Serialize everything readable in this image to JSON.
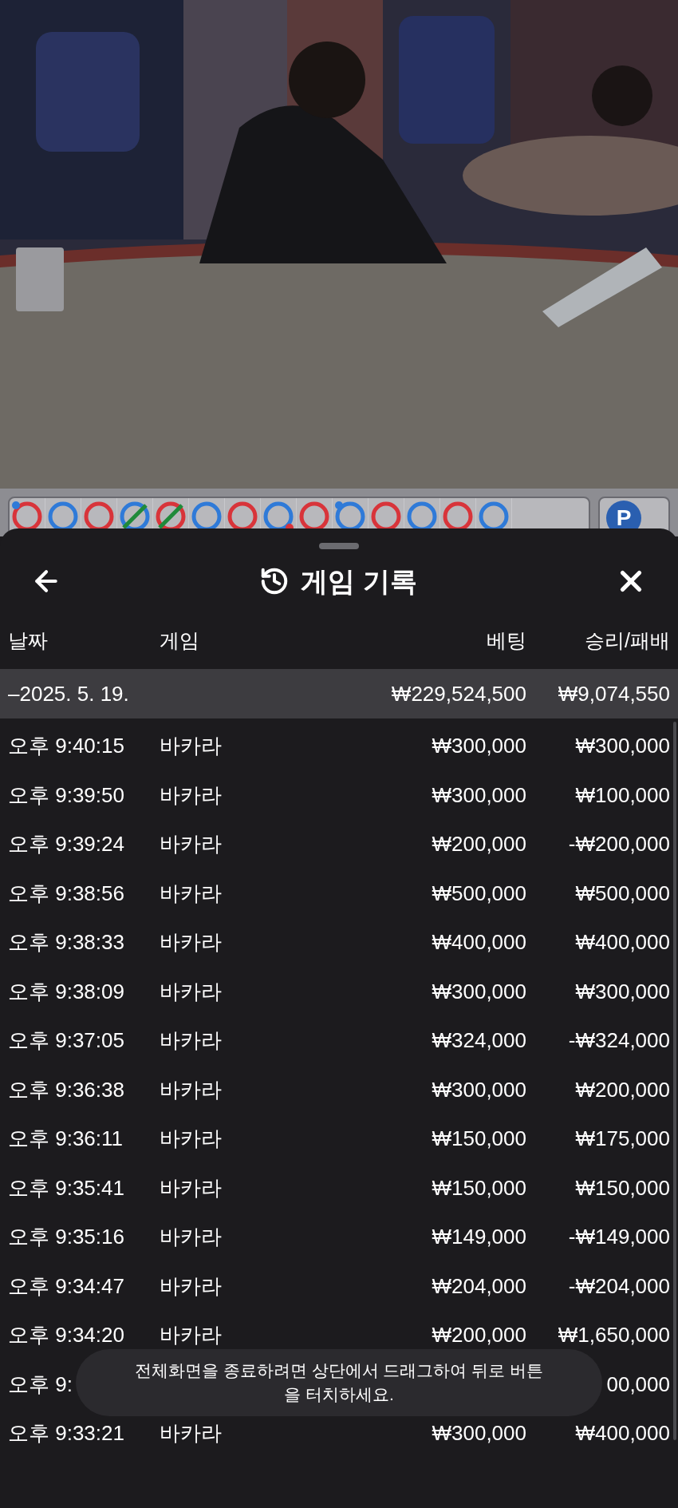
{
  "bead_road": {
    "beads": [
      {
        "color": "#d8343a",
        "tie": false,
        "marks": [
          {
            "kind": "upper",
            "color": "#2f7ad8"
          }
        ]
      },
      {
        "color": "#2f7ad8",
        "tie": false
      },
      {
        "color": "#d8343a",
        "tie": false
      },
      {
        "color": "#2f7ad8",
        "tie": true
      },
      {
        "color": "#d8343a",
        "tie": true
      },
      {
        "color": "#2f7ad8",
        "tie": false
      },
      {
        "color": "#d8343a",
        "tie": false
      },
      {
        "color": "#2f7ad8",
        "tie": false,
        "marks": [
          {
            "kind": "lower",
            "color": "#d8343a"
          }
        ]
      },
      {
        "color": "#d8343a",
        "tie": false
      },
      {
        "color": "#2f7ad8",
        "tie": false,
        "marks": [
          {
            "kind": "upper",
            "color": "#2f7ad8"
          }
        ]
      },
      {
        "color": "#d8343a",
        "tie": false
      },
      {
        "color": "#2f7ad8",
        "tie": false
      },
      {
        "color": "#d8343a",
        "tie": false
      },
      {
        "color": "#2f7ad8",
        "tie": false
      }
    ],
    "road_button": {
      "label": "P"
    }
  },
  "sheet": {
    "title": "게임 기록",
    "columns": [
      "날짜",
      "게임",
      "베팅",
      "승리/패배"
    ],
    "date_group": {
      "date": "–2025. 5. 19.",
      "bet": "₩229,524,500",
      "result": "₩9,074,550"
    },
    "rows": [
      {
        "time": "오후 9:40:15",
        "game": "바카라",
        "bet": "₩300,000",
        "result": "₩300,000"
      },
      {
        "time": "오후 9:39:50",
        "game": "바카라",
        "bet": "₩300,000",
        "result": "₩100,000"
      },
      {
        "time": "오후 9:39:24",
        "game": "바카라",
        "bet": "₩200,000",
        "result": "-₩200,000"
      },
      {
        "time": "오후 9:38:56",
        "game": "바카라",
        "bet": "₩500,000",
        "result": "₩500,000"
      },
      {
        "time": "오후 9:38:33",
        "game": "바카라",
        "bet": "₩400,000",
        "result": "₩400,000"
      },
      {
        "time": "오후 9:38:09",
        "game": "바카라",
        "bet": "₩300,000",
        "result": "₩300,000"
      },
      {
        "time": "오후 9:37:05",
        "game": "바카라",
        "bet": "₩324,000",
        "result": "-₩324,000"
      },
      {
        "time": "오후 9:36:38",
        "game": "바카라",
        "bet": "₩300,000",
        "result": "₩200,000"
      },
      {
        "time": "오후 9:36:11",
        "game": "바카라",
        "bet": "₩150,000",
        "result": "₩175,000"
      },
      {
        "time": "오후 9:35:41",
        "game": "바카라",
        "bet": "₩150,000",
        "result": "₩150,000"
      },
      {
        "time": "오후 9:35:16",
        "game": "바카라",
        "bet": "₩149,000",
        "result": "-₩149,000"
      },
      {
        "time": "오후 9:34:47",
        "game": "바카라",
        "bet": "₩204,000",
        "result": "-₩204,000"
      },
      {
        "time": "오후 9:34:20",
        "game": "바카라",
        "bet": "₩200,000",
        "result": "₩1,650,000"
      },
      {
        "time": "오후 9:",
        "result": "00,000"
      },
      {
        "time": "오후 9:33:21",
        "game": "바카라",
        "bet": "₩300,000",
        "result": "₩400,000"
      }
    ]
  },
  "toast": {
    "text": "전체화면을 종료하려면 상단에서 드래그하여 뒤로 버튼을 터치하세요."
  }
}
